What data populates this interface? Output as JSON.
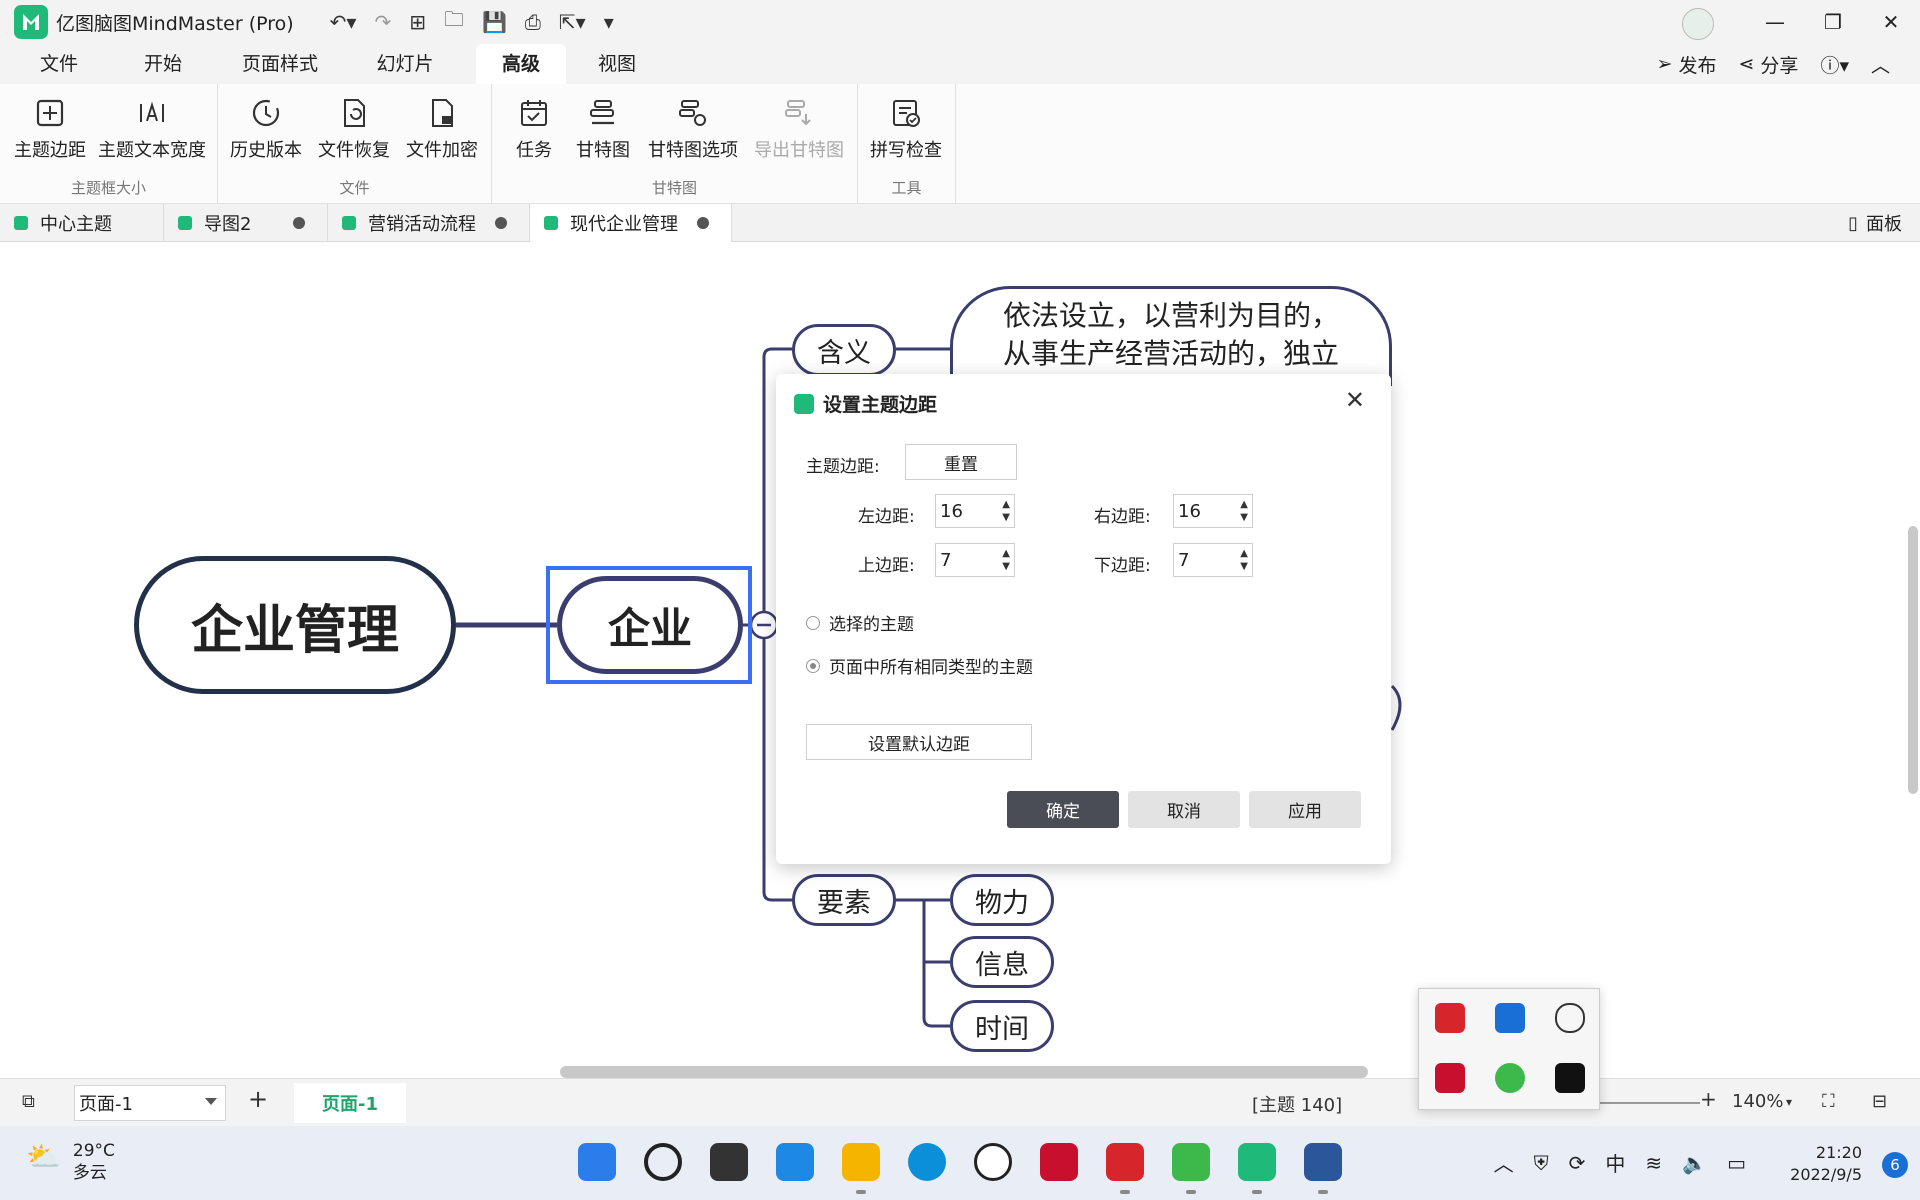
{
  "app": {
    "title": "亿图脑图MindMaster (Pro)"
  },
  "menu": {
    "tabs": [
      "文件",
      "开始",
      "页面样式",
      "幻灯片",
      "高级",
      "视图"
    ],
    "active": "高级",
    "publish": "发布",
    "share": "分享"
  },
  "ribbon": {
    "groups": [
      {
        "label": "主题框大小",
        "buttons": [
          "主题边距",
          "主题文本宽度"
        ]
      },
      {
        "label": "文件",
        "buttons": [
          "历史版本",
          "文件恢复",
          "文件加密"
        ]
      },
      {
        "label": "甘特图",
        "buttons": [
          "任务",
          "甘特图",
          "甘特图选项",
          "导出甘特图"
        ]
      },
      {
        "label": "工具",
        "buttons": [
          "拼写检查"
        ]
      }
    ]
  },
  "doc_tabs": [
    "中心主题",
    "导图2",
    "营销活动流程",
    "现代企业管理"
  ],
  "panel_label": "面板",
  "mindmap": {
    "root": "企业管理",
    "main": "企业",
    "topics": [
      "含义",
      "要素"
    ],
    "definition_text": [
      "依法设立，以营利为目的，",
      "从事生产经营活动的，独立"
    ],
    "subtopics": [
      "物力",
      "信息",
      "时间"
    ]
  },
  "dialog": {
    "title": "设置主题边距",
    "margin_label": "主题边距:",
    "reset": "重置",
    "left_label": "左边距:",
    "left": "16",
    "right_label": "右边距:",
    "right": "16",
    "top_label": "上边距:",
    "top": "7",
    "bottom_label": "下边距:",
    "bottom": "7",
    "radio_selected_topic": "选择的主题",
    "radio_all_same": "页面中所有相同类型的主题",
    "set_default": "设置默认边距",
    "ok": "确定",
    "cancel": "取消",
    "apply": "应用"
  },
  "status": {
    "page_select": "页面-1",
    "page_tab": "页面-1",
    "topic_count": "[主题 140]",
    "zoom": "140%"
  },
  "taskbar": {
    "temp": "29°C",
    "weather": "多云",
    "ime": "中",
    "time": "21:20",
    "date": "2022/9/5",
    "notifications": "6"
  },
  "colors": {
    "brand": "#1fb97a",
    "node_border": "#3b3d6e",
    "selection": "#3a6ff7"
  }
}
